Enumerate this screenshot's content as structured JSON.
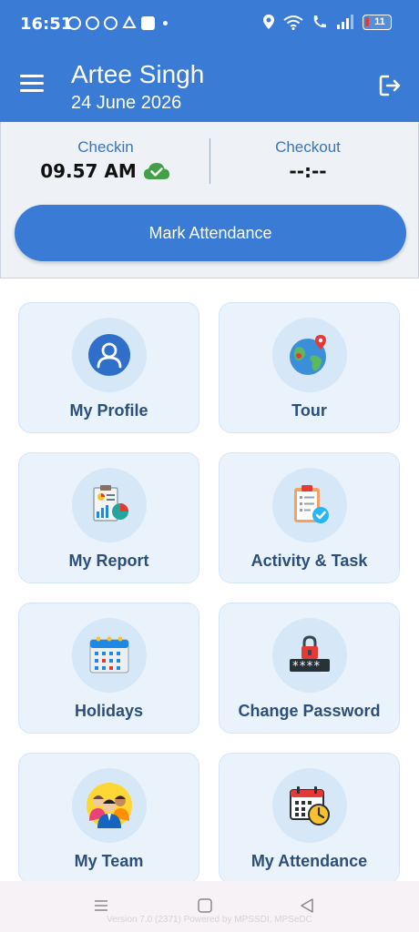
{
  "status_bar": {
    "time": "16:51",
    "battery": "11"
  },
  "header": {
    "user_name": "Artee Singh",
    "date": "24 June 2026"
  },
  "attendance": {
    "checkin_label": "Checkin",
    "checkin_time": "09.57 AM",
    "checkout_label": "Checkout",
    "checkout_time": "--:--",
    "mark_button": "Mark Attendance"
  },
  "tiles": [
    {
      "label": "My Profile",
      "icon": "profile-icon"
    },
    {
      "label": "Tour",
      "icon": "globe-icon"
    },
    {
      "label": "My Report",
      "icon": "report-icon"
    },
    {
      "label": "Activity & Task",
      "icon": "clipboard-icon"
    },
    {
      "label": "Holidays",
      "icon": "calendar-icon"
    },
    {
      "label": "Change Password",
      "icon": "password-lock-icon"
    },
    {
      "label": "My Team",
      "icon": "team-icon"
    },
    {
      "label": "My Attendance",
      "icon": "attendance-calendar-icon"
    }
  ],
  "footer": {
    "version": "Version 7.0 (2371) Powered by MPSSDI, MPSeDC"
  },
  "colors": {
    "primary": "#3a7bd5",
    "tile_bg": "#eaf3fc",
    "tile_text": "#2b4f7a",
    "success": "#43a047"
  }
}
